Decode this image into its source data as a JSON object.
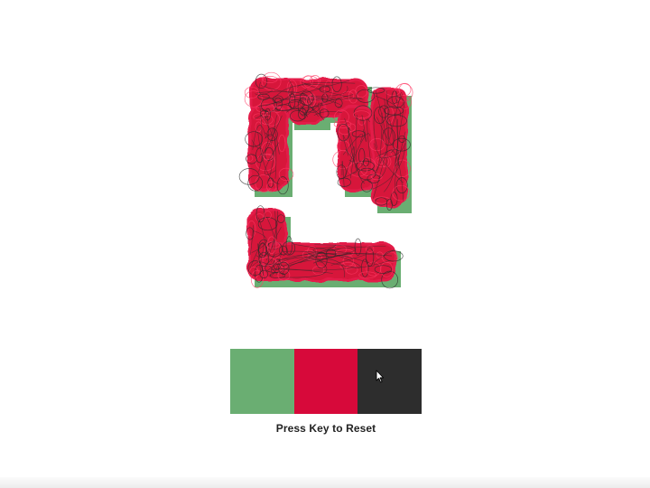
{
  "artwork": {
    "icon": "scribbled-korean-glyph",
    "colors": {
      "fill": "#d7173b",
      "shadow": "#6aae72",
      "scribble": "#2a2a2a",
      "outline": "#e31b48"
    }
  },
  "palette": {
    "swatches": [
      {
        "name": "green",
        "color": "#6aae72"
      },
      {
        "name": "red",
        "color": "#d7093a"
      },
      {
        "name": "black",
        "color": "#2d2d2d"
      }
    ]
  },
  "reset_label": "Press Key to Reset",
  "cursor": {
    "icon": "arrow-cursor-icon"
  }
}
